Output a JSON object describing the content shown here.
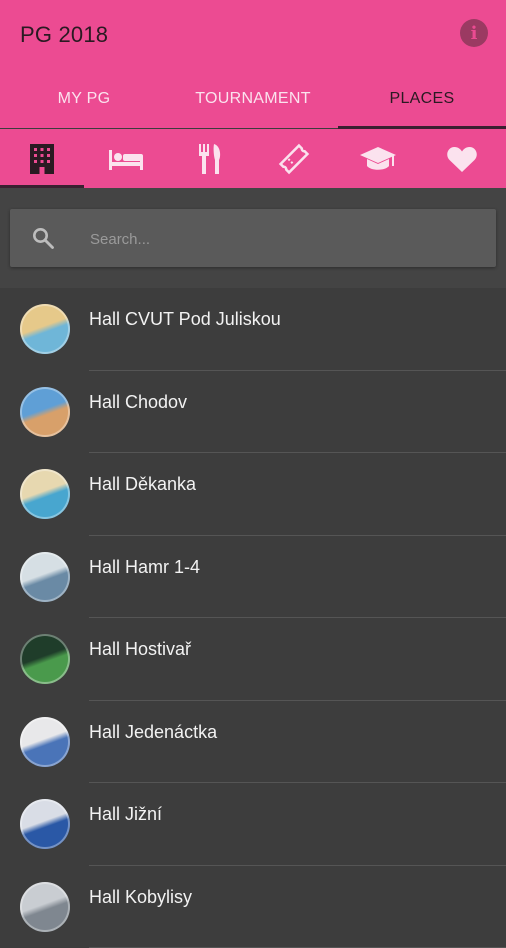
{
  "app": {
    "title": "PG 2018"
  },
  "tabs": [
    {
      "label": "MY PG"
    },
    {
      "label": "TOURNAMENT"
    },
    {
      "label": "PLACES"
    }
  ],
  "categories": [
    "building-icon",
    "bed-icon",
    "restaurant-icon",
    "ticket-icon",
    "graduation-cap-icon",
    "heart-icon"
  ],
  "search": {
    "placeholder": "Search..."
  },
  "places": [
    {
      "name": "Hall CVUT Pod Juliskou",
      "colors": [
        "#e6c98a",
        "#6fb6d8"
      ]
    },
    {
      "name": "Hall Chodov",
      "colors": [
        "#5f9fd6",
        "#d8a06a"
      ]
    },
    {
      "name": "Hall Děkanka",
      "colors": [
        "#e7d8b0",
        "#48a6cf"
      ]
    },
    {
      "name": "Hall Hamr 1-4",
      "colors": [
        "#d6dfe4",
        "#6a8aa5"
      ]
    },
    {
      "name": "Hall Hostivař",
      "colors": [
        "#1f3d2a",
        "#4a9a4c"
      ]
    },
    {
      "name": "Hall Jedenáctka",
      "colors": [
        "#e8e8ea",
        "#4a74b8"
      ]
    },
    {
      "name": "Hall Jižní",
      "colors": [
        "#d9dde6",
        "#2a58a6"
      ]
    },
    {
      "name": "Hall Kobylisy",
      "colors": [
        "#c9cdd2",
        "#7f8790"
      ]
    }
  ],
  "theme": {
    "primary": "#ec4b92",
    "background": "#3d3d3d"
  }
}
